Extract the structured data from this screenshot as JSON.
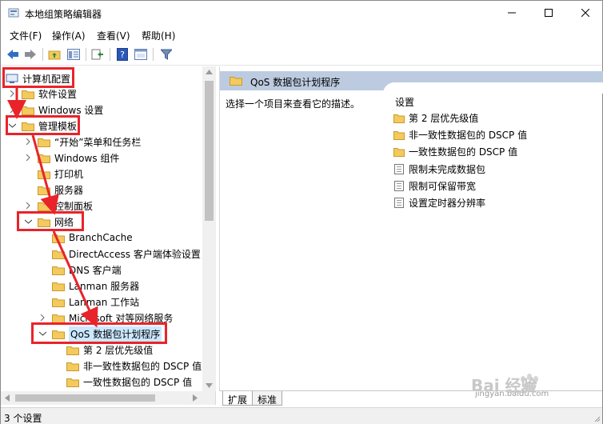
{
  "window": {
    "title": "本地组策略编辑器",
    "controls": [
      "minimize-icon",
      "maximize-icon",
      "close-icon"
    ]
  },
  "menubar": {
    "items": [
      "文件(F)",
      "操作(A)",
      "查看(V)",
      "帮助(H)"
    ]
  },
  "toolbar": {
    "icons": [
      "back-arrow-icon",
      "forward-arrow-icon",
      "up-folder-icon",
      "show-hide-tree-icon",
      "export-list-icon",
      "help-icon",
      "properties-icon",
      "filter-icon"
    ]
  },
  "tree": {
    "root": "计算机配置",
    "software": "软件设置",
    "windows_settings": "Windows 设置",
    "admin_templates": "管理模板",
    "start_menu": "“开始”菜单和任务栏",
    "windows_components": "Windows 组件",
    "printers": "打印机",
    "server": "服务器",
    "control_panel": "控制面板",
    "network": "网络",
    "branchcache": "BranchCache",
    "directaccess": "DirectAccess 客户端体验设置",
    "dns": "DNS 客户端",
    "lanman_server": "Lanman 服务器",
    "lanman_workstation": "Lanman 工作站",
    "microsoft_p2p": "Microsoft 对等网络服务",
    "qos": "QoS 数据包计划程序",
    "qos_layer2": "第 2 层优先级值",
    "qos_nonconform": "非一致性数据包的 DSCP 值",
    "qos_conform": "一致性数据包的 DSCP 值"
  },
  "right_pane": {
    "header_title": "QoS 数据包计划程序",
    "description": "选择一个项目来查看它的描述。",
    "settings_header": "设置",
    "settings": [
      {
        "label": "第 2 层优先级值",
        "icon": "folder-icon"
      },
      {
        "label": "非一致性数据包的 DSCP 值",
        "icon": "folder-icon"
      },
      {
        "label": "一致性数据包的 DSCP 值",
        "icon": "folder-icon"
      },
      {
        "label": "限制未完成数据包",
        "icon": "policy-setting-icon"
      },
      {
        "label": "限制可保留带宽",
        "icon": "policy-setting-icon"
      },
      {
        "label": "设置定时器分辨率",
        "icon": "policy-setting-icon"
      }
    ]
  },
  "tabs": {
    "extended": "扩展",
    "standard": "标准"
  },
  "status": {
    "text": "3 个设置"
  },
  "watermark": {
    "brand": "Bai 经验",
    "url": "jingyan.baidu.com"
  },
  "colors": {
    "annotation": "#e8242a",
    "header_band": "#bccbe0",
    "selection": "#cce8ff",
    "folder": "#f4c95d"
  }
}
